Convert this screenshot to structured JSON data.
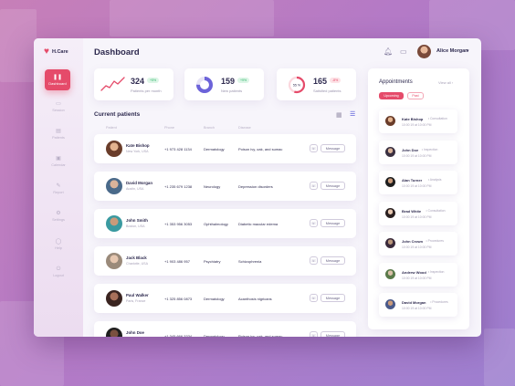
{
  "app": {
    "name": "H.Care",
    "page_title": "Dashboard",
    "accent": "#e54b6a",
    "link_accent": "#4a4fd6"
  },
  "sidebar": {
    "items": [
      {
        "label": "Dashboard",
        "icon": "pause-icon"
      },
      {
        "label": "Session",
        "icon": "calendar-icon"
      },
      {
        "label": "Patients",
        "icon": "clipboard-icon"
      },
      {
        "label": "Calendar",
        "icon": "calendar-icon"
      },
      {
        "label": "Report",
        "icon": "pen-icon"
      },
      {
        "label": "Settings",
        "icon": "gear-icon"
      },
      {
        "label": "Help",
        "icon": "help-icon"
      },
      {
        "label": "Logout",
        "icon": "logout-icon"
      }
    ]
  },
  "header": {
    "user_name": "Alice Morgan"
  },
  "stats": [
    {
      "value": "324",
      "label": "Patients per month",
      "badge": "+5%",
      "chart": "sparkline",
      "color": "#e54b6a"
    },
    {
      "value": "159",
      "label": "New patients",
      "badge": "+9%",
      "chart": "donut",
      "percent": 75,
      "color": "#6c63d9"
    },
    {
      "value": "165",
      "label": "Satisfied patients",
      "badge": "-8%",
      "chart": "ring",
      "percent": 55,
      "ring_label": "55 %",
      "color": "#e54b6a"
    }
  ],
  "patients": {
    "title": "Current patients",
    "columns": [
      "Patient",
      "Phone",
      "Branch",
      "Disease"
    ],
    "call_label": "☏",
    "message_label": "Message",
    "rows": [
      {
        "name": "Kate Bishop",
        "location": "New York, USA",
        "phone": "+1 973 428 1134",
        "branch": "Dermatology",
        "disease": "Poison ivy, oak, and sumac"
      },
      {
        "name": "David Morgan",
        "location": "Austin, USA",
        "phone": "+1 235 679 1238",
        "branch": "Neurology",
        "disease": "Depression disorders"
      },
      {
        "name": "John Smith",
        "location": "Boston, USA",
        "phone": "+1 353 956 3053",
        "branch": "Ophthalmology",
        "disease": "Diabetic macular edema"
      },
      {
        "name": "Jack Black",
        "location": "Charlotte, USA",
        "phone": "+1 903 486 957",
        "branch": "Psychiatry",
        "disease": "Schizophrenia"
      },
      {
        "name": "Paul Walker",
        "location": "Paris, France",
        "phone": "+1 325 856 0873",
        "branch": "Dermatology",
        "disease": "Acanthosis nigricans"
      },
      {
        "name": "John Doe",
        "location": "",
        "phone": "+1 345 666 3334",
        "branch": "Dermatology",
        "disease": "Poison ivy, oak, and sumac"
      }
    ]
  },
  "appointments": {
    "title": "Appointments",
    "view_all": "View all ›",
    "tabs": [
      "Upcoming",
      "Past"
    ],
    "items": [
      {
        "name": "Kate Bishop",
        "type": "• Consultation",
        "time": "10:00 19 at 10:00 PM"
      },
      {
        "name": "John Doe",
        "type": "• Inspection",
        "time": "10:00 19 at 10:00 PM"
      },
      {
        "name": "Alan Turner",
        "type": "• Analysis",
        "time": "10:00 19 at 10:00 PM"
      },
      {
        "name": "Brad White",
        "type": "• Consultation",
        "time": "10:00 19 at 10:00 PM"
      },
      {
        "name": "John Crown",
        "type": "• Procedures",
        "time": "10:00 19 at 10:00 PM"
      },
      {
        "name": "Andrew Wood",
        "type": "• Inspection",
        "time": "10:00 19 at 10:00 PM"
      },
      {
        "name": "David Morgan",
        "type": "• Procedures",
        "time": "10:00 19 at 10:00 PM"
      }
    ]
  }
}
